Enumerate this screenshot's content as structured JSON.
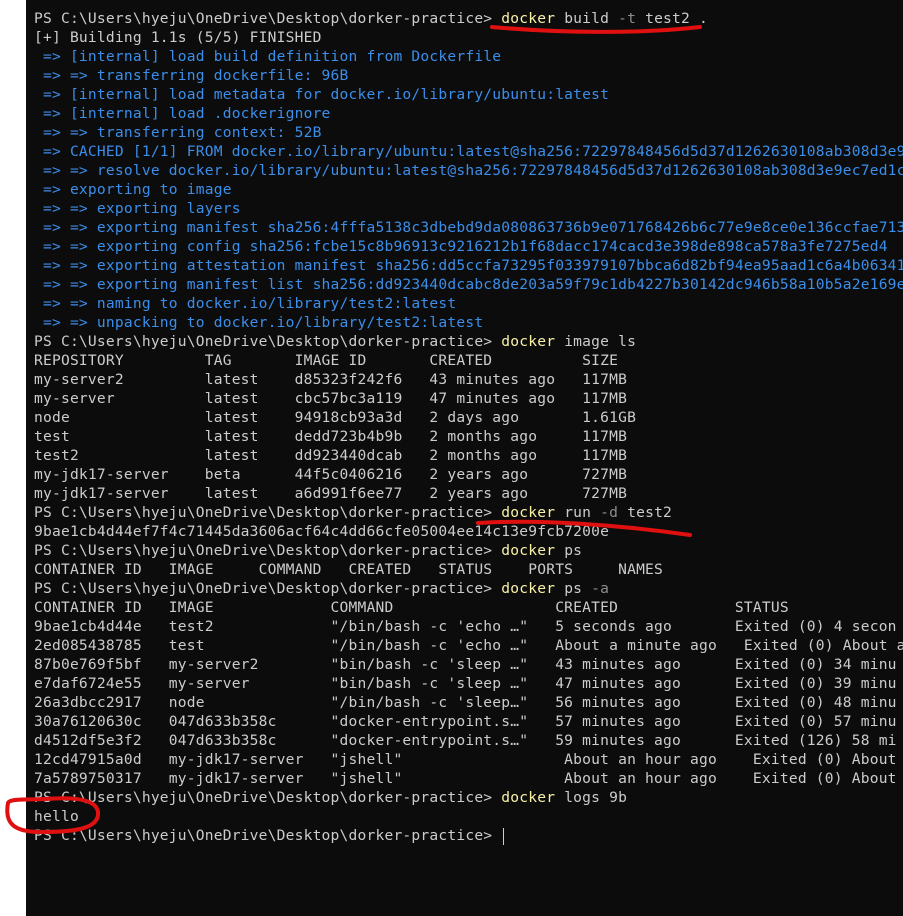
{
  "terminal": {
    "lines": [
      {
        "parts": [
          [
            "PS C:\\Users\\hyeju\\OneDrive\\Desktop\\dorker-practice> ",
            ""
          ],
          [
            "docker",
            "cmd"
          ],
          [
            " build ",
            ""
          ],
          [
            "-t",
            "flag"
          ],
          [
            " test2 .",
            ""
          ]
        ]
      },
      {
        "parts": [
          [
            "[+] Building 1.1s (5/5) FINISHED",
            ""
          ]
        ]
      },
      {
        "parts": [
          [
            " => [internal] load build definition from Dockerfile",
            "blue"
          ]
        ]
      },
      {
        "parts": [
          [
            " => => transferring dockerfile: 96B",
            "blue"
          ]
        ]
      },
      {
        "parts": [
          [
            " => [internal] load metadata for docker.io/library/ubuntu:latest",
            "blue"
          ]
        ]
      },
      {
        "parts": [
          [
            " => [internal] load .dockerignore",
            "blue"
          ]
        ]
      },
      {
        "parts": [
          [
            " => => transferring context: 52B",
            "blue"
          ]
        ]
      },
      {
        "parts": [
          [
            " => CACHED [1/1] FROM docker.io/library/ubuntu:latest@sha256:72297848456d5d37d1262630108ab308d3e9",
            "blue"
          ]
        ]
      },
      {
        "parts": [
          [
            " => => resolve docker.io/library/ubuntu:latest@sha256:72297848456d5d37d1262630108ab308d3e9ec7ed1c",
            "blue"
          ]
        ]
      },
      {
        "parts": [
          [
            " => exporting to image",
            "blue"
          ]
        ]
      },
      {
        "parts": [
          [
            " => => exporting layers",
            "blue"
          ]
        ]
      },
      {
        "parts": [
          [
            " => => exporting manifest sha256:4fffa5138c3dbebd9da080863736b9e071768426b6c77e9e8ce0e136ccfae713",
            "blue"
          ]
        ]
      },
      {
        "parts": [
          [
            " => => exporting config sha256:fcbe15c8b96913c9216212b1f68dacc174cacd3e398de898ca578a3fe7275ed4",
            "blue"
          ]
        ]
      },
      {
        "parts": [
          [
            " => => exporting attestation manifest sha256:dd5ccfa73295f033979107bbca6d82bf94ea95aad1c6a4b06341",
            "blue"
          ]
        ]
      },
      {
        "parts": [
          [
            " => => exporting manifest list sha256:dd923440dcabc8de203a59f79c1db4227b30142dc946b58a10b5a2e169e",
            "blue"
          ]
        ]
      },
      {
        "parts": [
          [
            " => => naming to docker.io/library/test2:latest",
            "blue"
          ]
        ]
      },
      {
        "parts": [
          [
            " => => unpacking to docker.io/library/test2:latest",
            "blue"
          ]
        ]
      },
      {
        "parts": [
          [
            "PS C:\\Users\\hyeju\\OneDrive\\Desktop\\dorker-practice> ",
            ""
          ],
          [
            "docker",
            "cmd"
          ],
          [
            " image ls",
            ""
          ]
        ]
      },
      {
        "parts": [
          [
            "REPOSITORY         TAG       IMAGE ID       CREATED          SIZE",
            ""
          ]
        ]
      },
      {
        "parts": [
          [
            "my-server2         latest    d85323f242f6   43 minutes ago   117MB",
            ""
          ]
        ]
      },
      {
        "parts": [
          [
            "my-server          latest    cbc57bc3a119   47 minutes ago   117MB",
            ""
          ]
        ]
      },
      {
        "parts": [
          [
            "node               latest    94918cb93a3d   2 days ago       1.61GB",
            ""
          ]
        ]
      },
      {
        "parts": [
          [
            "test               latest    dedd723b4b9b   2 months ago     117MB",
            ""
          ]
        ]
      },
      {
        "parts": [
          [
            "test2              latest    dd923440dcab   2 months ago     117MB",
            ""
          ]
        ]
      },
      {
        "parts": [
          [
            "my-jdk17-server    beta      44f5c0406216   2 years ago      727MB",
            ""
          ]
        ]
      },
      {
        "parts": [
          [
            "my-jdk17-server    latest    a6d991f6ee77   2 years ago      727MB",
            ""
          ]
        ]
      },
      {
        "parts": [
          [
            "PS C:\\Users\\hyeju\\OneDrive\\Desktop\\dorker-practice> ",
            ""
          ],
          [
            "docker",
            "cmd"
          ],
          [
            " run ",
            ""
          ],
          [
            "-d",
            "flag"
          ],
          [
            " test2",
            ""
          ]
        ]
      },
      {
        "parts": [
          [
            "9bae1cb4d44ef7f4c71445da3606acf64c4dd66cfe05004ee14c13e9fcb7200e",
            ""
          ]
        ]
      },
      {
        "parts": [
          [
            "PS C:\\Users\\hyeju\\OneDrive\\Desktop\\dorker-practice> ",
            ""
          ],
          [
            "docker",
            "cmd"
          ],
          [
            " ps",
            ""
          ]
        ]
      },
      {
        "parts": [
          [
            "CONTAINER ID   IMAGE     COMMAND   CREATED   STATUS    PORTS     NAMES",
            ""
          ]
        ]
      },
      {
        "parts": [
          [
            "PS C:\\Users\\hyeju\\OneDrive\\Desktop\\dorker-practice> ",
            ""
          ],
          [
            "docker",
            "cmd"
          ],
          [
            " ps ",
            ""
          ],
          [
            "-a",
            "flag"
          ]
        ]
      },
      {
        "parts": [
          [
            "CONTAINER ID   IMAGE             COMMAND                  CREATED             STATUS",
            ""
          ]
        ]
      },
      {
        "parts": [
          [
            "9bae1cb4d44e   test2             \"/bin/bash -c 'echo …\"   5 seconds ago       Exited (0) 4 secon",
            ""
          ]
        ]
      },
      {
        "parts": [
          [
            "2ed085438785   test              \"/bin/bash -c 'echo …\"   About a minute ago   Exited (0) About a",
            ""
          ]
        ]
      },
      {
        "parts": [
          [
            "87b0e769f5bf   my-server2        \"bin/bash -c 'sleep …\"   43 minutes ago      Exited (0) 34 minu",
            ""
          ]
        ]
      },
      {
        "parts": [
          [
            "e7daf6724e55   my-server         \"bin/bash -c 'sleep …\"   47 minutes ago      Exited (0) 39 minu",
            ""
          ]
        ]
      },
      {
        "parts": [
          [
            "26a3dbcc2917   node              \"/bin/bash -c 'sleep…\"   56 minutes ago      Exited (0) 48 minu",
            ""
          ]
        ]
      },
      {
        "parts": [
          [
            "30a76120630c   047d633b358c      \"docker-entrypoint.s…\"   57 minutes ago      Exited (0) 57 minu",
            ""
          ]
        ]
      },
      {
        "parts": [
          [
            "d4512df5e3f2   047d633b358c      \"docker-entrypoint.s…\"   59 minutes ago      Exited (126) 58 mi",
            ""
          ]
        ]
      },
      {
        "parts": [
          [
            "12cd47915a0d   my-jdk17-server   \"jshell\"                  About an hour ago    Exited (0) About",
            ""
          ]
        ]
      },
      {
        "parts": [
          [
            "7a5789750317   my-jdk17-server   \"jshell\"                  About an hour ago    Exited (0) About",
            ""
          ]
        ]
      },
      {
        "parts": [
          [
            "PS C:\\Users\\hyeju\\OneDrive\\Desktop\\dorker-practice> ",
            ""
          ],
          [
            "docker",
            "cmd"
          ],
          [
            " logs 9b",
            ""
          ]
        ]
      },
      {
        "parts": [
          [
            "hello",
            ""
          ]
        ]
      },
      {
        "parts": [
          [
            "PS C:\\Users\\hyeju\\OneDrive\\Desktop\\dorker-practice> ",
            ""
          ]
        ],
        "cursor": true
      }
    ]
  },
  "annotation": {
    "stroke_color": "#e01010"
  }
}
